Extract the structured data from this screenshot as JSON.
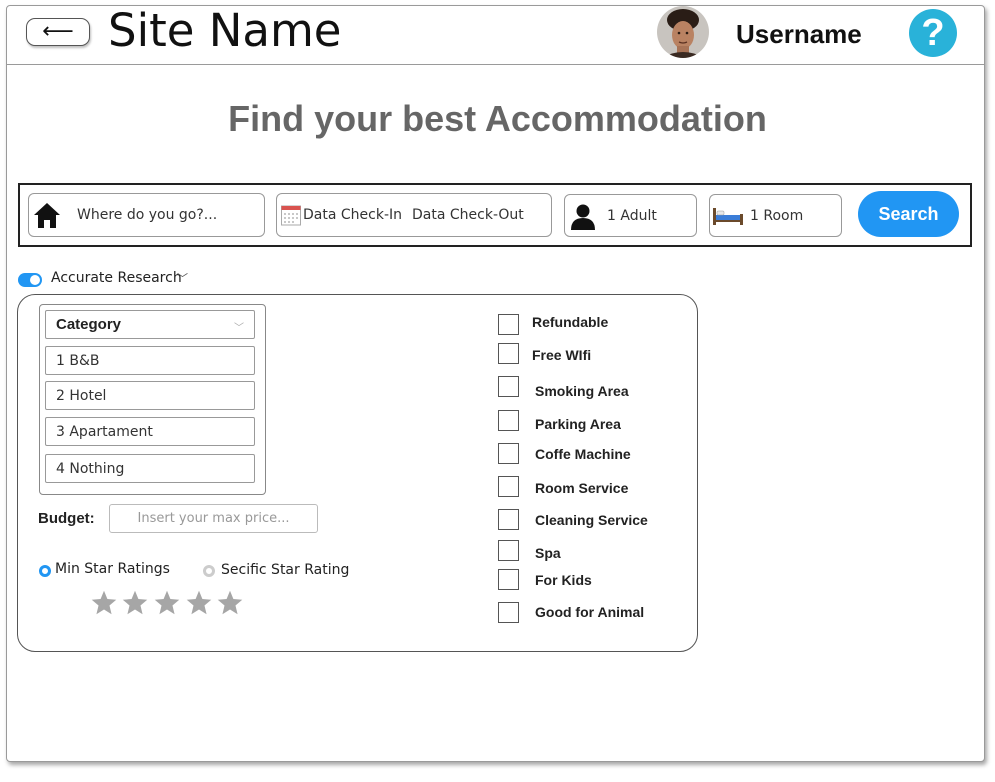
{
  "header": {
    "back_label": "⟵",
    "site_name": "Site Name",
    "username": "Username",
    "help_label": "?"
  },
  "headline": "Find your best Accommodation",
  "search": {
    "destination_placeholder": "Where do you go?...",
    "checkin_label": "Data Check-In",
    "checkout_label": "Data Check-Out",
    "guests_value": "1 Adult",
    "rooms_value": "1 Room",
    "search_label": "Search"
  },
  "accurate_research": {
    "label": "Accurate Research",
    "enabled": true
  },
  "category": {
    "header": "Category",
    "options": [
      "1 B&B",
      "2 Hotel",
      "3 Apartament",
      "4 Nothing"
    ]
  },
  "budget": {
    "label": "Budget:",
    "placeholder": "Insert your max price..."
  },
  "star_rating": {
    "min_label": "Min Star Ratings",
    "specific_label": "Secific Star Rating",
    "selected": "min",
    "stars_filled": 0,
    "stars_total": 5
  },
  "amenities": [
    "Refundable",
    "Free WIfi",
    "Smoking Area",
    "Parking Area",
    "Coffe Machine",
    "Room Service",
    "Cleaning Service",
    "Spa",
    "For Kids",
    "Good for Animal"
  ],
  "colors": {
    "accent": "#2196f3",
    "help": "#29b2d9",
    "headline": "#666666"
  }
}
